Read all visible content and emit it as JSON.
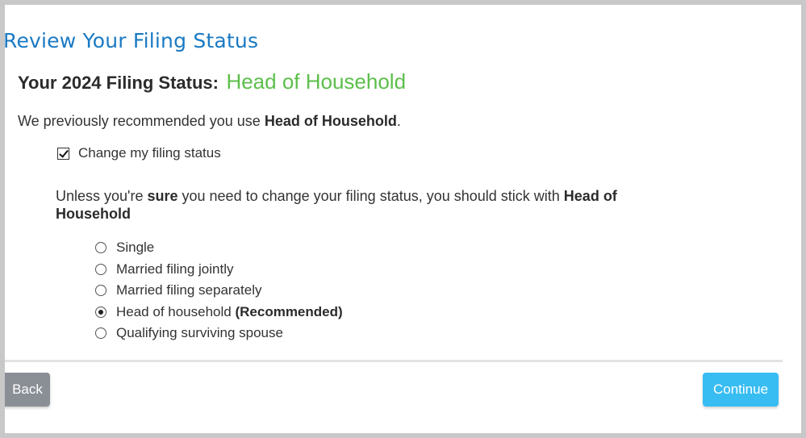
{
  "page": {
    "title": "Review Your Filing Status"
  },
  "status": {
    "label": "Your 2024 Filing Status:",
    "value": "Head of Household"
  },
  "recommendation": {
    "prefix": "We previously recommended you use ",
    "value": "Head of Household",
    "suffix": "."
  },
  "change_checkbox": {
    "label": "Change my filing status",
    "checked": true
  },
  "warning": {
    "prefix": "Unless you're ",
    "emphasis": "sure",
    "middle": " you need to change your filing status, you should stick with ",
    "status": "Head of Household"
  },
  "filing_options": [
    {
      "label": "Single",
      "note": "",
      "selected": false
    },
    {
      "label": "Married filing jointly",
      "note": "",
      "selected": false
    },
    {
      "label": "Married filing separately",
      "note": "",
      "selected": false
    },
    {
      "label": "Head of household",
      "note": "(Recommended)",
      "selected": true
    },
    {
      "label": "Qualifying surviving spouse",
      "note": "",
      "selected": false
    }
  ],
  "buttons": {
    "back": "Back",
    "continue": "Continue"
  },
  "colors": {
    "title": "#1a7ac4",
    "status_value": "#5cbf4a",
    "continue_button": "#38bdf2",
    "back_button": "#8a8f96"
  }
}
